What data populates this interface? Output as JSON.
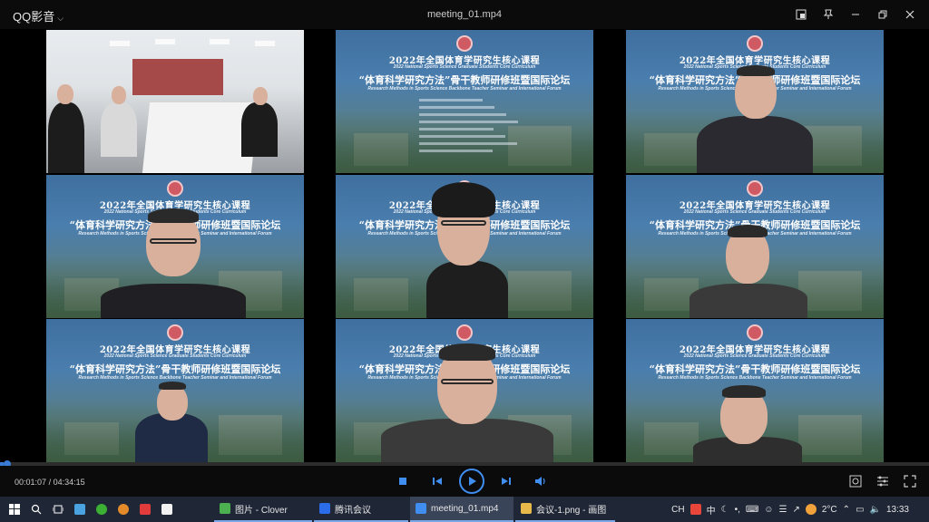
{
  "titlebar": {
    "app_name": "QQ影音",
    "file_title": "meeting_01.mp4"
  },
  "video": {
    "slide": {
      "line1": "2022年全国体育学研究生核心课程",
      "line2": "2022 National Sports Science Graduate Students Core Curriculum",
      "line3": "“体育科学研究方法”骨干教师研修班暨国际论坛",
      "line4": "Research Methods in Sports Science Backbone Teacher Seminar and International Forum"
    }
  },
  "playback": {
    "elapsed": "00:01:07",
    "total": "04:34:15",
    "progress_fraction": 0.004
  },
  "taskbar": {
    "apps": [
      {
        "label": "图片 - Clover",
        "color": "#4caf50"
      },
      {
        "label": "腾讯会议",
        "color": "#2b6de8"
      },
      {
        "label": "meeting_01.mp4",
        "color": "#3f8ef0"
      },
      {
        "label": "会议-1.png - 画图",
        "color": "#e7b84a"
      }
    ],
    "tray": {
      "lang": "CH",
      "ime": "中",
      "temperature": "2°C",
      "clock": "13:33"
    }
  },
  "colors": {
    "accent": "#3f8ef0",
    "taskbar": "#1f2636"
  }
}
